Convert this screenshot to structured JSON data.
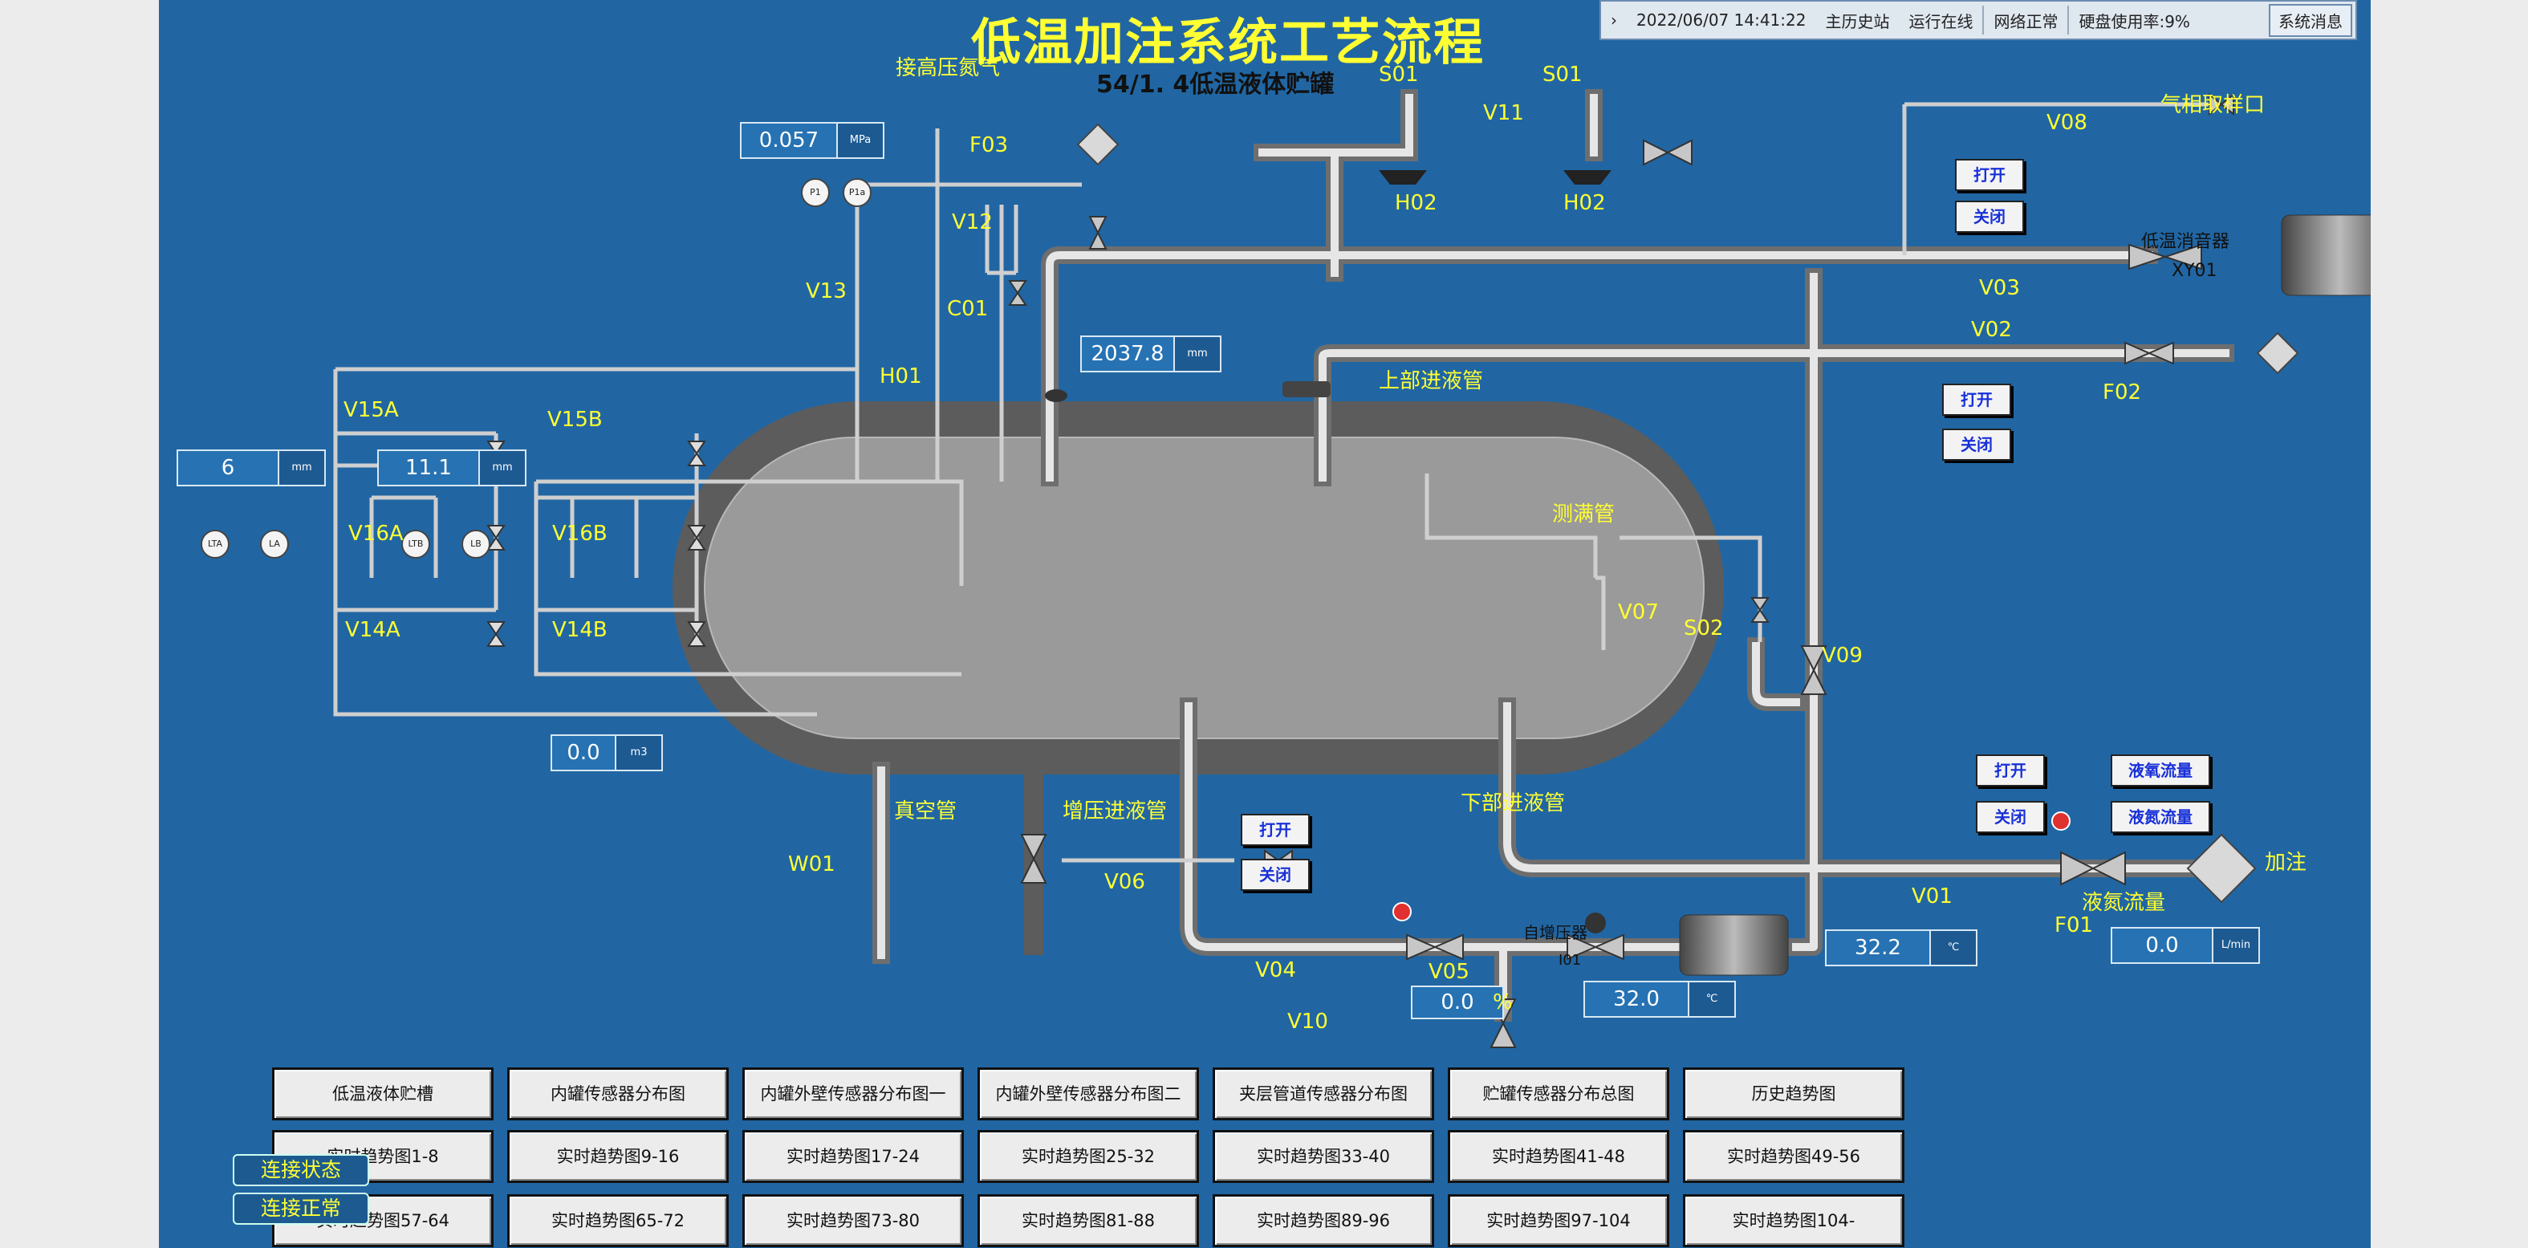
{
  "title": "低温加注系统工艺流程",
  "subtitle": "54/1. 4低温液体贮罐",
  "status_bar": {
    "datetime": "2022/06/07 14:41:22",
    "station": "主历史站",
    "run_state": "运行在线",
    "network": "网络正常",
    "disk": "硬盘使用率:9%",
    "system_msg": "系统消息"
  },
  "readouts": {
    "pressure": {
      "value": "0.057",
      "unit": "MPa"
    },
    "level": {
      "value": "2037.8",
      "unit": "mm"
    },
    "level_a": {
      "value": "6",
      "unit": "mm"
    },
    "level_b": {
      "value": "11.1",
      "unit": "mm"
    },
    "volume": {
      "value": "0.0",
      "unit": "m3"
    },
    "v05_open": {
      "value": "0.0",
      "unit": "%"
    },
    "vaporizer_temp": {
      "value": "32.0",
      "unit": "℃"
    },
    "fill_temp": {
      "value": "32.2",
      "unit": "℃"
    },
    "flow": {
      "value": "0.0",
      "unit": "L/min"
    }
  },
  "labels": {
    "hp_nitrogen": "接高压氮气",
    "f03": "F03",
    "v12": "V12",
    "c01": "C01",
    "v13": "V13",
    "h01": "H01",
    "s01_left": "S01",
    "s01_right": "S01",
    "v11": "V11",
    "h02_left": "H02",
    "h02_right": "H02",
    "v08": "V08",
    "gas_sample": "气相取样口",
    "v03": "V03",
    "silencer_name": "低温消音器",
    "silencer_id": "XY01",
    "v02": "V02",
    "f02": "F02",
    "upper_inlet": "上部进液管",
    "overflow": "测满管",
    "v07": "V07",
    "s02": "S02",
    "v09": "V09",
    "v15a": "V15A",
    "v16a": "V16A",
    "v14a": "V14A",
    "v15b": "V15B",
    "v16b": "V16B",
    "v14b": "V14B",
    "vacuum": "真空管",
    "w01": "W01",
    "boost_inlet": "增压进液管",
    "v06": "V06",
    "lower_inlet": "下部进液管",
    "v04": "V04",
    "v05": "V05",
    "v10": "V10",
    "vaporizer_name": "自增压器",
    "vaporizer_id": "I01",
    "v01": "V01",
    "f01": "F01",
    "fill": "加注",
    "lq_flow": "液氮流量"
  },
  "gauges": {
    "p1": "P1",
    "p1a": "P1a",
    "lta": "LTA",
    "la": "LA",
    "ltb": "LTB",
    "lb": "LB"
  },
  "buttons": {
    "open": "打开",
    "close": "关闭",
    "lox_flow": "液氧流量",
    "ln2_flow": "液氮流量"
  },
  "nav": [
    "低温液体贮槽",
    "内罐传感器分布图",
    "内罐外壁传感器分布图一",
    "内罐外壁传感器分布图二",
    "夹层管道传感器分布图",
    "贮罐传感器分布总图",
    "历史趋势图",
    "实时趋势图1-8",
    "实时趋势图9-16",
    "实时趋势图17-24",
    "实时趋势图25-32",
    "实时趋势图33-40",
    "实时趋势图41-48",
    "实时趋势图49-56",
    "实时趋势图57-64",
    "实时趋势图65-72",
    "实时趋势图73-80",
    "实时趋势图81-88",
    "实时趋势图89-96",
    "实时趋势图97-104",
    "实时趋势图104-"
  ],
  "connection": {
    "label": "连接状态",
    "value": "连接正常"
  },
  "colors": {
    "background": "#2166a3",
    "label": "#ffff33",
    "tank_outer": "#5c5c5c",
    "tank_inner": "#9a9a9a",
    "pipe": "#c8c8c8"
  }
}
